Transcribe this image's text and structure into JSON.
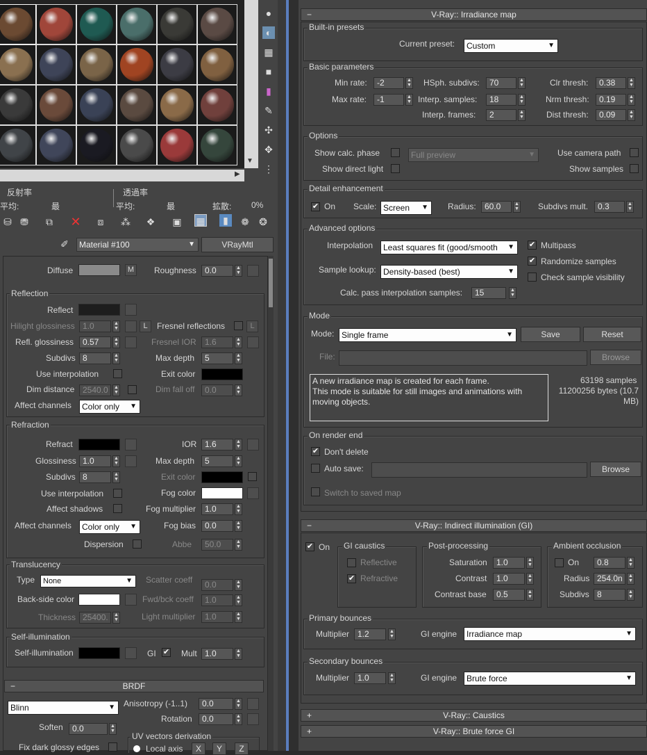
{
  "irradiance": {
    "title": "V-Ray:: Irradiance map",
    "builtin": {
      "group": "Built-in presets",
      "current_label": "Current preset:",
      "current_value": "Custom"
    },
    "basic": {
      "group": "Basic parameters",
      "min_rate_label": "Min rate:",
      "min_rate": "-2",
      "max_rate_label": "Max rate:",
      "max_rate": "-1",
      "hsph_label": "HSph. subdivs:",
      "hsph": "70",
      "interp_samples_label": "Interp. samples:",
      "interp_samples": "18",
      "interp_frames_label": "Interp. frames:",
      "interp_frames": "2",
      "clr_label": "Clr thresh:",
      "clr": "0.38",
      "nrm_label": "Nrm thresh:",
      "nrm": "0.19",
      "dist_label": "Dist thresh:",
      "dist": "0.09"
    },
    "options": {
      "group": "Options",
      "show_calc": "Show calc. phase",
      "show_direct": "Show direct light",
      "preview": "Full preview",
      "use_camera": "Use camera path",
      "show_samples": "Show samples"
    },
    "detail": {
      "group": "Detail enhancement",
      "on": "On",
      "scale_label": "Scale:",
      "scale": "Screen",
      "radius_label": "Radius:",
      "radius": "60.0",
      "subdivs_label": "Subdivs mult.",
      "subdivs": "0.3"
    },
    "advanced": {
      "group": "Advanced options",
      "interp_label": "Interpolation",
      "interp": "Least squares fit (good/smooth",
      "lookup_label": "Sample lookup:",
      "lookup": "Density-based (best)",
      "calc_label": "Calc. pass interpolation samples:",
      "calc": "15",
      "multipass": "Multipass",
      "randomize": "Randomize samples",
      "check_vis": "Check sample visibility"
    },
    "mode": {
      "group": "Mode",
      "mode_label": "Mode:",
      "mode": "Single frame",
      "save": "Save",
      "reset": "Reset",
      "file_label": "File:",
      "browse": "Browse",
      "desc": "A new irradiance map is created for each frame.\nThis mode is suitable for still images and animations with moving objects.",
      "samples": "63198 samples",
      "bytes": "11200256 bytes (10.7 MB)"
    },
    "render_end": {
      "group": "On render end",
      "dont_delete": "Don't delete",
      "auto_save": "Auto save:",
      "browse": "Browse",
      "switch": "Switch to saved map"
    }
  },
  "gi": {
    "title": "V-Ray:: Indirect illumination (GI)",
    "on": "On",
    "caustics": {
      "group": "GI caustics",
      "reflective": "Reflective",
      "refractive": "Refractive"
    },
    "post": {
      "group": "Post-processing",
      "saturation_label": "Saturation",
      "saturation": "1.0",
      "contrast_label": "Contrast",
      "contrast": "1.0",
      "contrast_base_label": "Contrast base",
      "contrast_base": "0.5"
    },
    "ao": {
      "group": "Ambient occlusion",
      "on": "On",
      "on_value": "0.8",
      "radius_label": "Radius",
      "radius": "254.0n",
      "subdivs_label": "Subdivs",
      "subdivs": "8"
    },
    "primary": {
      "group": "Primary bounces",
      "mult_label": "Multiplier",
      "mult": "1.2",
      "engine_label": "GI engine",
      "engine": "Irradiance map"
    },
    "secondary": {
      "group": "Secondary bounces",
      "mult_label": "Multiplier",
      "mult": "1.0",
      "engine_label": "GI engine",
      "engine": "Brute force"
    }
  },
  "collapsed": [
    "V-Ray:: Caustics",
    "V-Ray:: Brute force GI"
  ],
  "material": {
    "stats": {
      "reflect": "反射率",
      "avg1": "平均:",
      "max1": "最",
      "transmit": "透過率",
      "avg2": "平均:",
      "max2": "最",
      "diffuse": "拡散:",
      "pct": "0%"
    },
    "name": "Material #100",
    "type": "VRayMtl",
    "diffuse_label": "Diffuse",
    "m": "M",
    "roughness_label": "Roughness",
    "roughness": "0.0",
    "reflection": {
      "group": "Reflection",
      "reflect": "Reflect",
      "hilight_label": "Hilight glossiness",
      "hilight": "1.0",
      "l": "L",
      "fresnel_label": "Fresnel reflections",
      "refl_gloss_label": "Refl. glossiness",
      "refl_gloss": "0.57",
      "fresnel_ior_label": "Fresnel IOR",
      "fresnel_ior": "1.6",
      "subdivs_label": "Subdivs",
      "subdivs": "8",
      "max_depth_label": "Max depth",
      "max_depth": "5",
      "use_interp": "Use interpolation",
      "exit_color": "Exit color",
      "dim_dist_label": "Dim distance",
      "dim_dist": "2540.0",
      "dim_fall_label": "Dim fall off",
      "dim_fall": "0.0",
      "affect_label": "Affect channels",
      "affect": "Color only"
    },
    "refraction": {
      "group": "Refraction",
      "refract": "Refract",
      "ior_label": "IOR",
      "ior": "1.6",
      "gloss_label": "Glossiness",
      "gloss": "1.0",
      "max_depth_label": "Max depth",
      "max_depth": "5",
      "subdivs_label": "Subdivs",
      "subdivs": "8",
      "exit_color": "Exit color",
      "use_interp": "Use interpolation",
      "fog_color": "Fog color",
      "affect_shadows": "Affect shadows",
      "fog_mult_label": "Fog multiplier",
      "fog_mult": "1.0",
      "affect_label": "Affect channels",
      "affect": "Color only",
      "fog_bias_label": "Fog bias",
      "fog_bias": "0.0",
      "dispersion": "Dispersion",
      "abbe_label": "Abbe",
      "abbe": "50.0"
    },
    "translucency": {
      "group": "Translucency",
      "type_label": "Type",
      "type": "None",
      "scatter_label": "Scatter coeff",
      "scatter": "0.0",
      "backside_label": "Back-side color",
      "fwd_label": "Fwd/bck coeff",
      "fwd": "1.0",
      "thickness_label": "Thickness",
      "thickness": "25400.",
      "light_mult_label": "Light multiplier",
      "light_mult": "1.0"
    },
    "selfillum": {
      "group": "Self-illumination",
      "label": "Self-illumination",
      "gi": "GI",
      "mult_label": "Mult",
      "mult": "1.0"
    },
    "brdf": {
      "title": "BRDF",
      "type": "Blinn",
      "aniso_label": "Anisotropy (-1..1)",
      "aniso": "0.0",
      "rotation_label": "Rotation",
      "rotation": "0.0",
      "soften_label": "Soften",
      "soften": "0.0",
      "uv_label": "UV vectors derivation",
      "fix_label": "Fix dark glossy edges",
      "local_axis": "Local axis",
      "x": "X",
      "y": "Y",
      "z": "Z"
    }
  },
  "spheres": [
    [
      "#6b4a32",
      "#a0463a",
      "#1f5a52",
      "#4a6e6a",
      "#3a3a36",
      "#5a4a44"
    ],
    [
      "#8a7050",
      "#3e4458",
      "#7a6448",
      "#a04422",
      "#3c3c44",
      "#806040"
    ],
    [
      "#3a3a3a",
      "#6a4a3a",
      "#3a4256",
      "#5a4a40",
      "#8a6a48",
      "#70403c"
    ],
    [
      "#404448",
      "#40465a",
      "#1a1a22",
      "#4a4a4a",
      "#9a3a3a",
      "#35463c"
    ]
  ]
}
